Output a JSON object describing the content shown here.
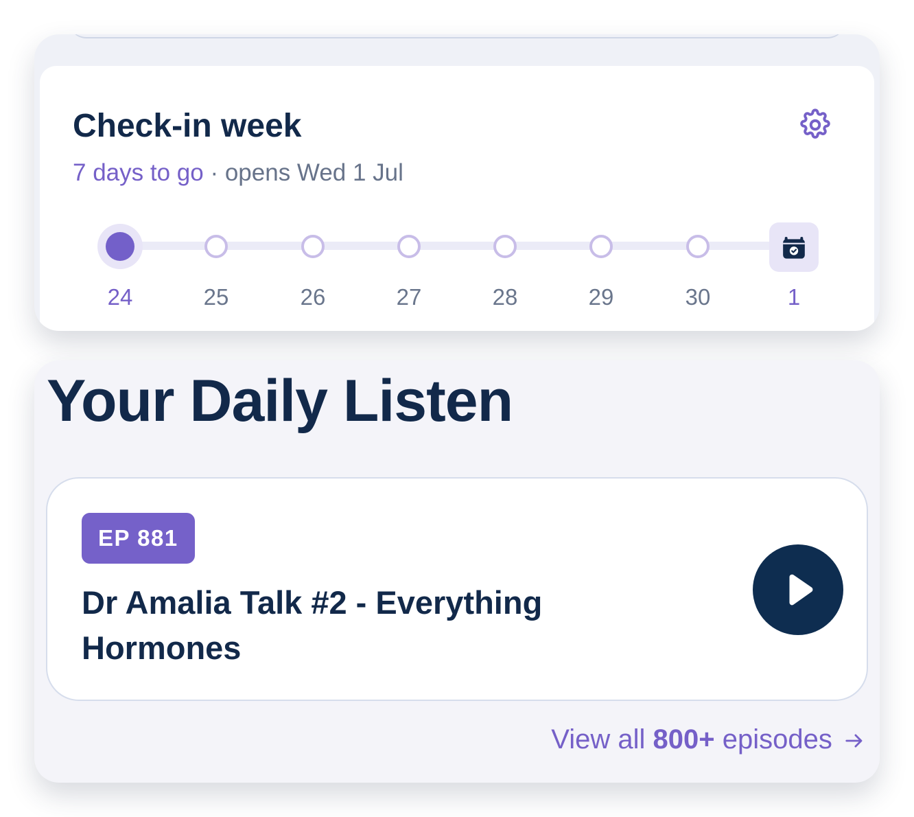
{
  "checkin": {
    "title": "Check-in week",
    "countdown": "7 days to go",
    "separator": "·",
    "opens": "opens Wed 1 Jul",
    "days": [
      "24",
      "25",
      "26",
      "27",
      "28",
      "29",
      "30",
      "1"
    ],
    "active_day": "24",
    "end_day": "1"
  },
  "daily_listen": {
    "title": "Your Daily Listen",
    "episode": {
      "badge": "EP 881",
      "title": "Dr Amalia Talk #2 - Everything Hormones"
    },
    "view_all_prefix": "View all",
    "view_all_count": "800+",
    "view_all_suffix": "episodes"
  },
  "icons": {
    "settings": "gear-icon",
    "calendar": "calendar-check-icon",
    "play": "play-icon",
    "arrow": "arrow-right-icon"
  },
  "colors": {
    "accent": "#7560c8",
    "navy": "#12294a",
    "play_bg": "#0e2d50",
    "muted_text": "#67738a"
  }
}
